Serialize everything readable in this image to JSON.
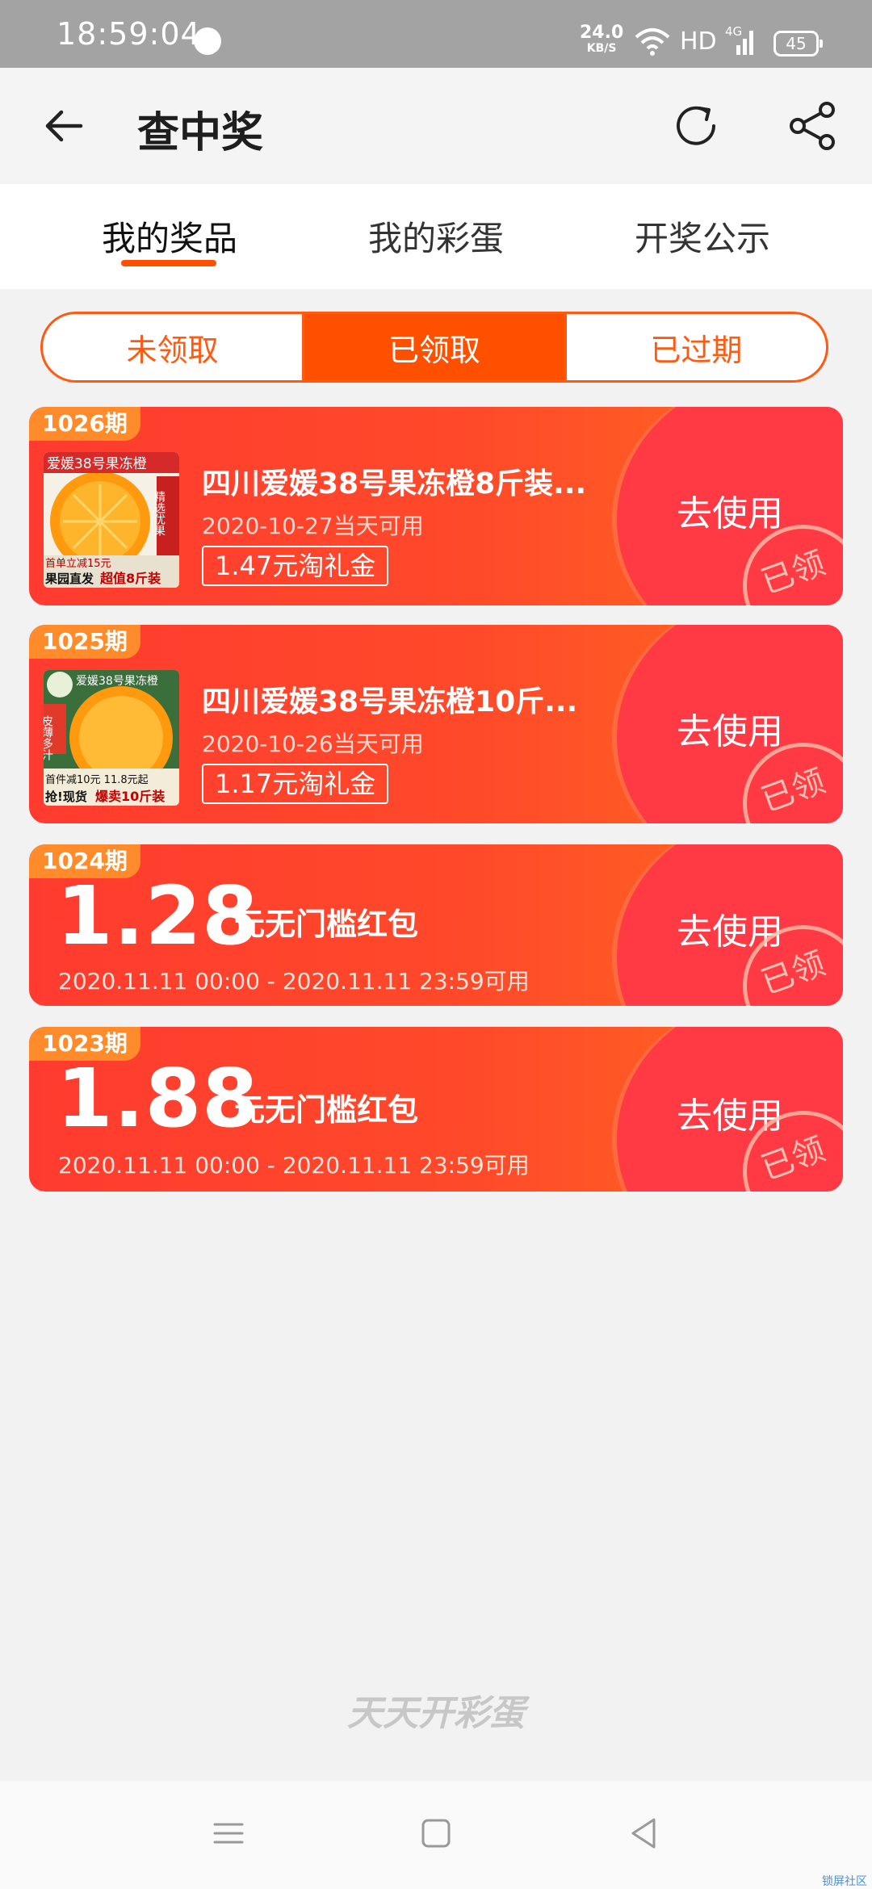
{
  "status_bar": {
    "time": "18:59:04",
    "net_speed": "24.0",
    "net_unit": "KB/S",
    "hd": "HD",
    "signal_label": "4G",
    "battery": "45"
  },
  "header": {
    "title": "查中奖",
    "icons": [
      "back-arrow-icon",
      "refresh-icon",
      "share-icon"
    ]
  },
  "tabs": [
    {
      "label": "我的奖品",
      "active": true
    },
    {
      "label": "我的彩蛋",
      "active": false
    },
    {
      "label": "开奖公示",
      "active": false
    }
  ],
  "segments": [
    {
      "label": "未领取",
      "active": false
    },
    {
      "label": "已领取",
      "active": true
    },
    {
      "label": "已过期",
      "active": false
    }
  ],
  "cards": [
    {
      "period": "1026期",
      "product": "四川爱媛38号果冻橙8斤装...",
      "date": "2020-10-27当天可用",
      "value": "1.47元淘礼金",
      "action": "去使用",
      "stamp": "已领",
      "thumb_text": {
        "top": "爱媛38号果冻橙",
        "side": "精选优果",
        "promo": "首单立减15元",
        "bottom1": "果园直发",
        "bottom2": "超值8斤装"
      }
    },
    {
      "period": "1025期",
      "product": "四川爱媛38号果冻橙10斤...",
      "date": "2020-10-26当天可用",
      "value": "1.17元淘礼金",
      "action": "去使用",
      "stamp": "已领",
      "thumb_text": {
        "top": "爱媛38号果冻橙",
        "side": "皮薄多汁",
        "promo": "首件减10元 11.8元起",
        "bottom1": "抢!现货",
        "bottom2": "爆卖10斤装"
      }
    },
    {
      "period": "1024期",
      "amount": "1.28",
      "amount_label": "元无门槛红包",
      "range": "2020.11.11 00:00 - 2020.11.11 23:59可用",
      "action": "去使用",
      "stamp": "已领"
    },
    {
      "period": "1023期",
      "amount": "1.88",
      "amount_label": "元无门槛红包",
      "range": "2020.11.11 00:00 - 2020.11.11 23:59可用",
      "action": "去使用",
      "stamp": "已领"
    }
  ],
  "footer": {
    "brand": "天天开彩蛋",
    "corner": "锁屏社区"
  },
  "colors": {
    "accent": "#ff5000",
    "card_start": "#ff3b2f",
    "card_end": "#ff6a1f",
    "period_tag": "#ff8b2a"
  }
}
